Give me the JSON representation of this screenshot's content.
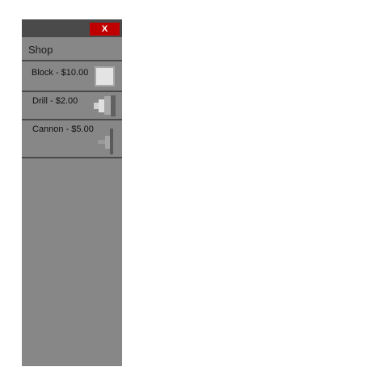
{
  "window": {
    "close_label": "X"
  },
  "shop": {
    "title": "Shop",
    "items": [
      {
        "name": "Block",
        "price": "$10.00",
        "label": "Block - $10.00",
        "icon": "block-icon"
      },
      {
        "name": "Drill",
        "price": "$2.00",
        "label": "Drill - $2.00",
        "icon": "drill-icon"
      },
      {
        "name": "Cannon",
        "price": "$5.00",
        "label": "Cannon - $5.00",
        "icon": "cannon-icon"
      }
    ]
  },
  "colors": {
    "panel": "#878787",
    "titlebar": "#4a4a4a",
    "close_button": "#c00000",
    "divider": "#4a4a4a"
  }
}
